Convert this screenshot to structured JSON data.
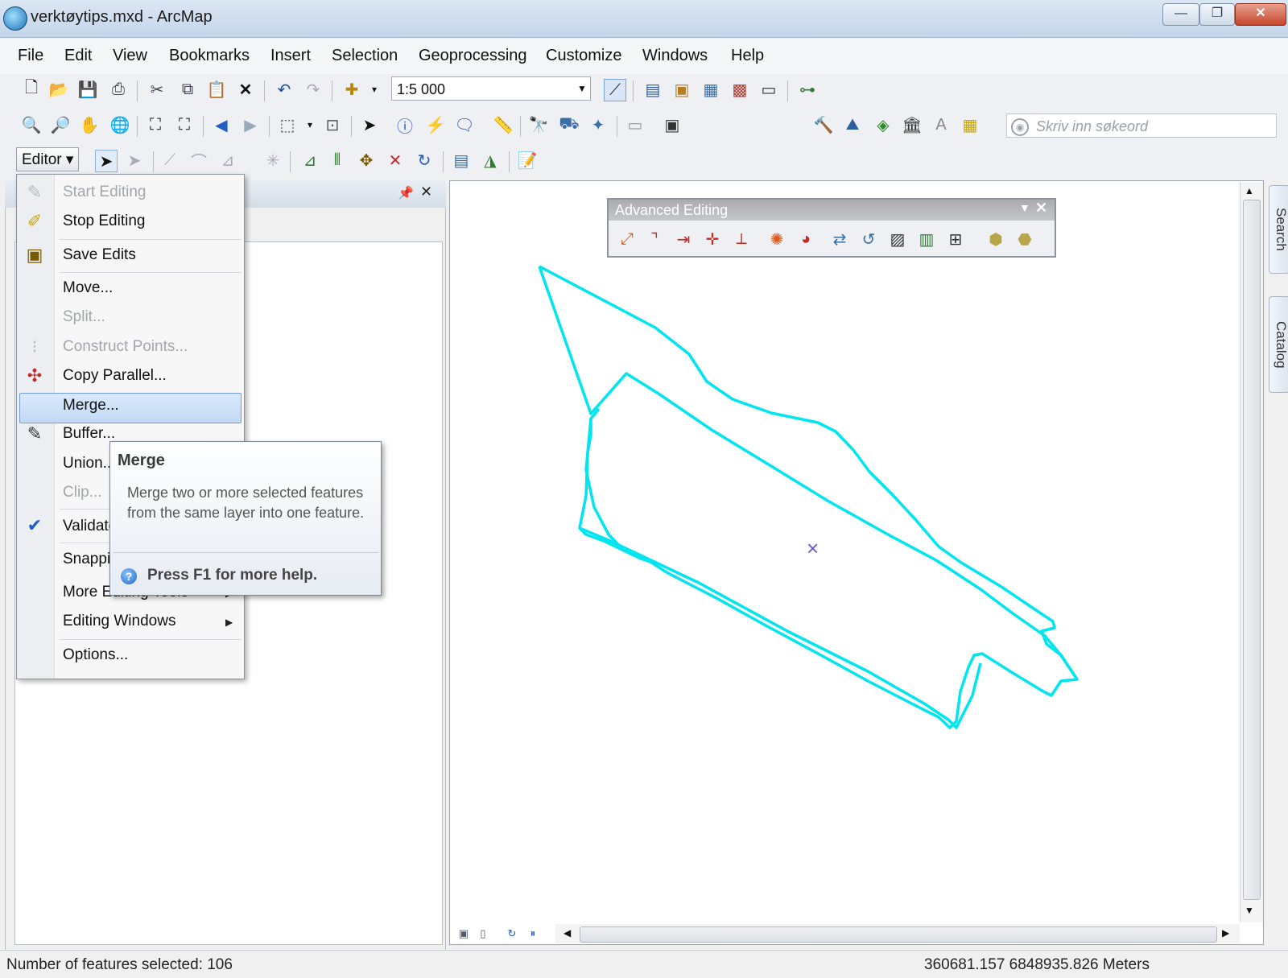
{
  "window": {
    "title": "verktøytips.mxd - ArcMap",
    "minimize": "—",
    "maximize": "❐",
    "close": "✕"
  },
  "menubar": [
    "File",
    "Edit",
    "View",
    "Bookmarks",
    "Insert",
    "Selection",
    "Geoprocessing",
    "Customize",
    "Windows",
    "Help"
  ],
  "toolbar": {
    "scale_value": "1:5 000",
    "search_placeholder": "Skriv inn søkeord",
    "editor_label": "Editor ▾"
  },
  "editor_menu": {
    "items": [
      {
        "label": "Start Editing",
        "enabled": false,
        "icon": "pencil-icon"
      },
      {
        "label": "Stop Editing",
        "enabled": true,
        "icon": "stop-editing-icon"
      },
      {
        "label": "Save Edits",
        "enabled": true,
        "icon": "save-edits-icon"
      },
      {
        "label": "Move...",
        "enabled": true
      },
      {
        "label": "Split...",
        "enabled": false
      },
      {
        "label": "Construct Points...",
        "enabled": false,
        "icon": "construct-points-icon"
      },
      {
        "label": "Copy Parallel...",
        "enabled": true,
        "icon": "copy-parallel-icon"
      },
      {
        "label": "Merge...",
        "enabled": true,
        "highlighted": true
      },
      {
        "label": "Buffer...",
        "enabled": true,
        "icon": "buffer-icon"
      },
      {
        "label": "Union...",
        "enabled": true
      },
      {
        "label": "Clip...",
        "enabled": false
      },
      {
        "label": "Validate Features",
        "enabled": true,
        "icon": "validate-icon"
      },
      {
        "label": "Snapping",
        "enabled": true
      },
      {
        "label": "More Editing Tools",
        "enabled": true,
        "submenu": true
      },
      {
        "label": "Editing Windows",
        "enabled": true,
        "submenu": true
      },
      {
        "label": "Options...",
        "enabled": true
      }
    ]
  },
  "tooltip": {
    "title": "Merge",
    "description": "Merge two or more selected features from the same layer into one feature.",
    "help": "Press F1 for more help."
  },
  "advanced_editing": {
    "title": "Advanced Editing"
  },
  "dock_tabs": [
    "Search",
    "Catalog"
  ],
  "status": {
    "selection": "Number of features selected: 106",
    "coordinates": "360681.157  6848935.826 Meters"
  },
  "colors": {
    "feature_outline": "#00e5f0",
    "menu_highlight": "#c2d9f6",
    "center_marker": "#6a5acd"
  }
}
